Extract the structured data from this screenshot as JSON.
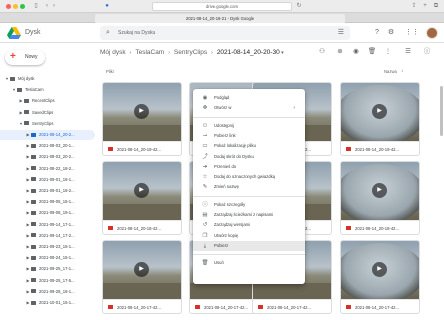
{
  "browser": {
    "url": "drive.google.com",
    "tab_title": "2021-08-14_20-19-21 - Dysk Google"
  },
  "header": {
    "app_name": "Dysk",
    "search_placeholder": "Szukaj na Dysku"
  },
  "sidebar": {
    "new_button": "Nowy",
    "tree": [
      {
        "label": "Mój dysk",
        "depth": 0,
        "expanded": true
      },
      {
        "label": "TeslaCam",
        "depth": 1,
        "expanded": true
      },
      {
        "label": "RecentClips",
        "depth": 2,
        "expanded": false
      },
      {
        "label": "SavedClips",
        "depth": 2,
        "expanded": false
      },
      {
        "label": "SentryClips",
        "depth": 2,
        "expanded": true
      },
      {
        "label": "2021-08-14_20-2...",
        "depth": 3,
        "expanded": false,
        "selected": true
      },
      {
        "label": "2021-08-03_20-1...",
        "depth": 3,
        "expanded": false
      },
      {
        "label": "2021-08-03_20-2...",
        "depth": 3,
        "expanded": false
      },
      {
        "label": "2021-08-22_18-2...",
        "depth": 3,
        "expanded": false
      },
      {
        "label": "2021-09-01_18-1...",
        "depth": 3,
        "expanded": false
      },
      {
        "label": "2021-09-01_18-2...",
        "depth": 3,
        "expanded": false
      },
      {
        "label": "2021-09-05_18-1...",
        "depth": 3,
        "expanded": false
      },
      {
        "label": "2021-09-08_19-1...",
        "depth": 3,
        "expanded": false
      },
      {
        "label": "2021-09-14_17-1...",
        "depth": 3,
        "expanded": false
      },
      {
        "label": "2021-09-14_17-2...",
        "depth": 3,
        "expanded": false
      },
      {
        "label": "2021-09-23_18-1...",
        "depth": 3,
        "expanded": false
      },
      {
        "label": "2021-09-24_18-1...",
        "depth": 3,
        "expanded": false
      },
      {
        "label": "2021-09-25_17-1...",
        "depth": 3,
        "expanded": false
      },
      {
        "label": "2021-09-25_17-5...",
        "depth": 3,
        "expanded": false
      },
      {
        "label": "2021-09-28_18-1...",
        "depth": 3,
        "expanded": false
      },
      {
        "label": "2021-10-01_15-1...",
        "depth": 3,
        "expanded": false
      }
    ]
  },
  "breadcrumb": [
    "Mój dysk",
    "TeslaCam",
    "SentryClips",
    "2021-08-14_20-20-30"
  ],
  "list_label": "Pliki",
  "sort_label": "Nazwa",
  "files": [
    {
      "name": "2021-08-14_20-19-42...",
      "style": "a"
    },
    {
      "name": "2021-08-14_20-19-42...",
      "style": "b"
    },
    {
      "name": "2021-08-14_20-19-42...",
      "style": "a"
    },
    {
      "name": "2021-08-14_20-19-42...",
      "style": "fish"
    },
    {
      "name": "2021-08-14_20-18-42...",
      "style": "a"
    },
    {
      "name": "2021-08-14_20-18-42...",
      "style": "b"
    },
    {
      "name": "2021-08-14_20-18-42...",
      "style": "a"
    },
    {
      "name": "2021-08-14_20-18-42...",
      "style": "fish"
    },
    {
      "name": "2021-08-14_20-17-42...",
      "style": "a"
    },
    {
      "name": "2021-08-14_20-17-42...",
      "style": "b"
    },
    {
      "name": "2021-08-14_20-17-42...",
      "style": "a"
    },
    {
      "name": "2021-08-14_20-17-42...",
      "style": "fish"
    }
  ],
  "context_menu": {
    "items": [
      {
        "label": "Podgląd",
        "icon": "eye-icon",
        "glyph": "◉"
      },
      {
        "label": "Otwórz w",
        "icon": "open-with-icon",
        "glyph": "✥",
        "submenu": true
      },
      {
        "sep": true
      },
      {
        "label": "Udostępnij",
        "icon": "share-icon",
        "glyph": "⚇"
      },
      {
        "label": "Pobierz link",
        "icon": "link-icon",
        "glyph": "⊸"
      },
      {
        "label": "Pokaż lokalizację pliku",
        "icon": "folder-icon",
        "glyph": "▭"
      },
      {
        "label": "Dodaj skrót do Dysku",
        "icon": "shortcut-icon",
        "glyph": "⤴"
      },
      {
        "label": "Przenieś do",
        "icon": "move-icon",
        "glyph": "➔"
      },
      {
        "label": "Dodaj do oznaczonych gwiazdką",
        "icon": "star-icon",
        "glyph": "☆"
      },
      {
        "label": "Zmień nazwę",
        "icon": "edit-icon",
        "glyph": "✎"
      },
      {
        "sep": true
      },
      {
        "label": "Pokaż szczegóły",
        "icon": "info-icon",
        "glyph": "ⓘ"
      },
      {
        "label": "Zarządzaj ścieżkami z napisami",
        "icon": "captions-icon",
        "glyph": "▤"
      },
      {
        "label": "Zarządzaj wersjami",
        "icon": "history-icon",
        "glyph": "↺"
      },
      {
        "label": "Utwórz kopię",
        "icon": "copy-icon",
        "glyph": "❐"
      },
      {
        "label": "Pobierz",
        "icon": "download-icon",
        "glyph": "⤓",
        "highlighted": true
      },
      {
        "sep": true
      },
      {
        "label": "Usuń",
        "icon": "trash-icon",
        "glyph": "🗑"
      }
    ]
  },
  "colors": {
    "accent": "#1967d2",
    "selected_bg": "#e8f0fe",
    "video_icon": "#d93025"
  }
}
